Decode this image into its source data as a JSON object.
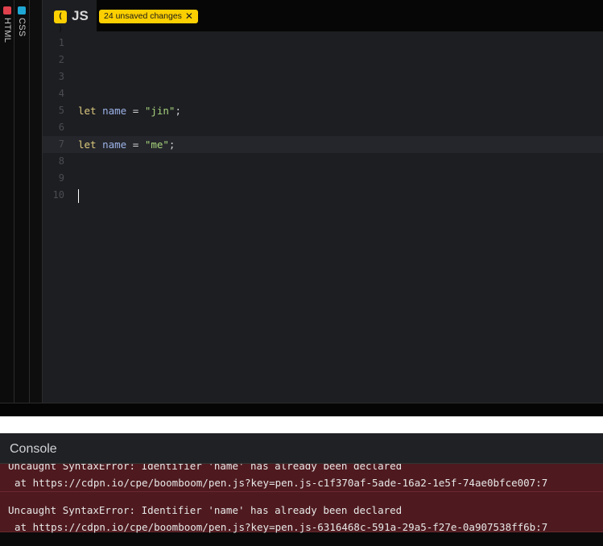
{
  "side_tabs": [
    {
      "label": "HTML",
      "color": "#e0414d"
    },
    {
      "label": "CSS",
      "color": "#1ea7d4"
    }
  ],
  "editor": {
    "tab_label": "JS",
    "tab_icon": "( )",
    "unsaved_label": "24 unsaved changes",
    "unsaved_close": "✕",
    "line_numbers": [
      "1",
      "2",
      "3",
      "4",
      "5",
      "6",
      "7",
      "8",
      "9",
      "10"
    ],
    "lines": {
      "l5": {
        "kw": "let",
        "var": "name",
        "op": "=",
        "str": "\"jin\"",
        "punc": ";"
      },
      "l7": {
        "kw": "let",
        "var": "name",
        "op": "=",
        "str": "\"me\"",
        "punc": ";"
      }
    }
  },
  "console": {
    "title": "Console",
    "entries": [
      {
        "message": "Uncaught SyntaxError: Identifier 'name' has already been declared",
        "stack": "at https://cdpn.io/cpe/boomboom/pen.js?key=pen.js-c1f370af-5ade-16a2-1e5f-74ae0bfce007:7"
      },
      {
        "message": "Uncaught SyntaxError: Identifier 'name' has already been declared",
        "stack": "at https://cdpn.io/cpe/boomboom/pen.js?key=pen.js-6316468c-591a-29a5-f27e-0a907538ff6b:7"
      }
    ]
  },
  "colors": {
    "accent_yellow": "#fcd000",
    "error_bg": "#4e1a1f",
    "editor_bg": "#1d1e22"
  }
}
